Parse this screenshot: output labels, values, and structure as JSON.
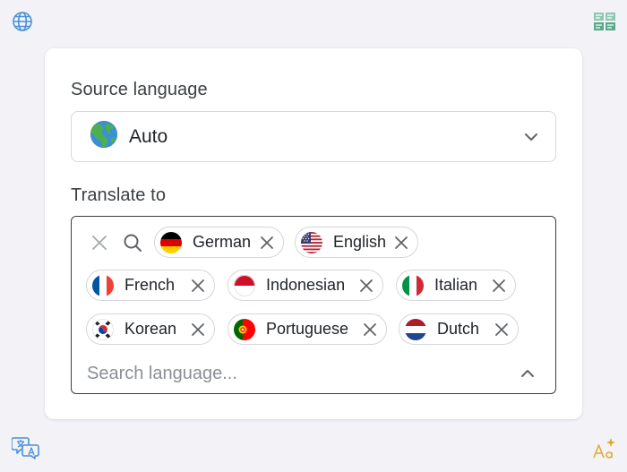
{
  "source": {
    "label": "Source language",
    "selected": "Auto",
    "selected_icon": "globe-emoji-icon"
  },
  "target": {
    "label": "Translate to",
    "selected": [
      {
        "name": "German",
        "flag": "germany-flag-icon"
      },
      {
        "name": "English",
        "flag": "usa-flag-icon"
      },
      {
        "name": "French",
        "flag": "france-flag-icon"
      },
      {
        "name": "Indonesian",
        "flag": "indonesia-flag-icon"
      },
      {
        "name": "Italian",
        "flag": "italy-flag-icon"
      },
      {
        "name": "Korean",
        "flag": "korea-flag-icon"
      },
      {
        "name": "Portuguese",
        "flag": "portugal-flag-icon"
      },
      {
        "name": "Dutch",
        "flag": "netherlands-flag-icon"
      }
    ],
    "search_placeholder": "Search language..."
  },
  "corner_icons": [
    "globe-icon",
    "layout-grid-icon",
    "translate-chat-icon",
    "font-sparkle-icon"
  ],
  "colors": {
    "accent": "#3a3d42",
    "background": "#f2f2f7",
    "corner_icon": "#4a90d9"
  }
}
